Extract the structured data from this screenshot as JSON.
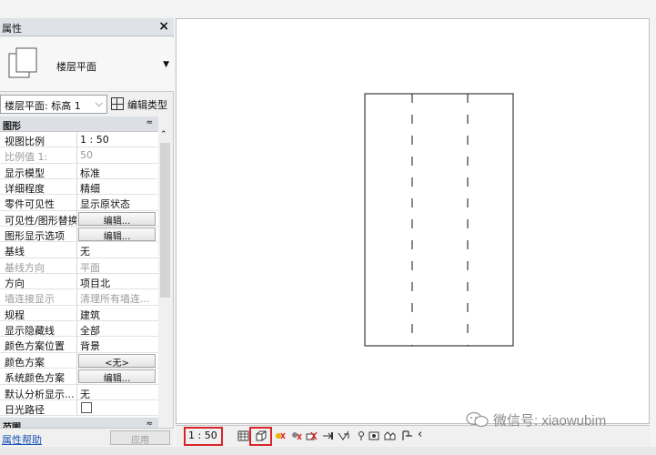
{
  "properties": {
    "title": "属性",
    "close_glyph": "×",
    "type_name": "楼层平面",
    "instance_selector": "楼层平面: 标高 1",
    "edit_type_label": "编辑类型",
    "groups": [
      {
        "name": "图形",
        "collapse_glyph": "≈"
      },
      {
        "name": "范围",
        "collapse_glyph": "≈"
      }
    ],
    "rows": [
      {
        "key": "视图比例",
        "value": "1 : 50"
      },
      {
        "key": "比例值 1:",
        "value": "50"
      },
      {
        "key": "显示模型",
        "value": "标准"
      },
      {
        "key": "详细程度",
        "value": "精细"
      },
      {
        "key": "零件可见性",
        "value": "显示原状态"
      },
      {
        "key": "可见性/图形替换",
        "value": "编辑..."
      },
      {
        "key": "图形显示选项",
        "value": "编辑..."
      },
      {
        "key": "基线",
        "value": "无"
      },
      {
        "key": "基线方向",
        "value": "平面"
      },
      {
        "key": "方向",
        "value": "项目北"
      },
      {
        "key": "墙连接显示",
        "value": "清理所有墙连..."
      },
      {
        "key": "规程",
        "value": "建筑"
      },
      {
        "key": "显示隐藏线",
        "value": "全部"
      },
      {
        "key": "颜色方案位置",
        "value": "背景"
      },
      {
        "key": "颜色方案",
        "value": "<无>"
      },
      {
        "key": "系统颜色方案",
        "value": "编辑..."
      },
      {
        "key": "默认分析显示...",
        "value": "无"
      },
      {
        "key": "日光路径",
        "value": ""
      }
    ],
    "help_link": "属性帮助",
    "apply_label": "应用"
  },
  "view_bar": {
    "scale": "1 : 50"
  },
  "watermark": {
    "text": "微信号: xiaowubim"
  },
  "colors": {
    "highlight": "#d9252a",
    "link": "#1a55b6"
  }
}
